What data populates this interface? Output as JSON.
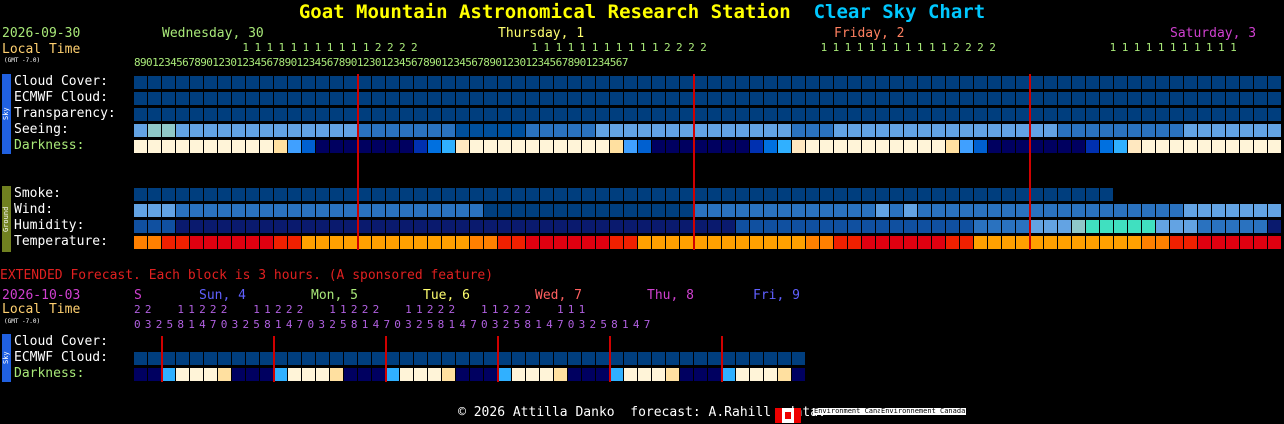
{
  "title": "Goat Mountain Astronomical Research Station",
  "title_suffix": "Clear Sky Chart",
  "main": {
    "date": "2026-09-30",
    "local_time": "Local Time",
    "gmt": "(GMT -7.0)",
    "days": [
      {
        "label": "Wednesday, 30",
        "color": "#a8e878"
      },
      {
        "label": "Thursday, 1",
        "color": "#ffff70"
      },
      {
        "label": "Friday, 2",
        "color": "#ff8060"
      },
      {
        "label": "Saturday, 3",
        "color": "#d040d0"
      }
    ],
    "hour_tens": "                  1 1 1 1 1 1 1 1 1 1 1 2 2 2 2                   1 1 1 1 1 1 1 1 1 1 1 2 2 2 2                   1 1 1 1 1 1 1 1 1 1 1 2 2 2 2                   1 1 1 1 1 1 1 1 1 1 1",
    "hour_ones": "8901234567890123012345678901234567890123012345678901234567890123012345678901234567",
    "sky_rows": [
      "Cloud Cover:",
      "ECMWF Cloud:",
      "Transparency:",
      "Seeing:",
      "Darkness:"
    ],
    "ground_rows": [
      "Smoke:",
      "Wind:",
      "Humidity:",
      "Temperature:"
    ],
    "sky_tab": "Sky",
    "ground_tab": "Ground"
  },
  "extended": {
    "header": "EXTENDED Forecast. Each block is 3 hours. (A sponsored feature)",
    "date": "2026-10-03",
    "local_time": "Local Time",
    "gmt": "(GMT -7.0)",
    "days": [
      {
        "label": "S",
        "color": "#d040d0"
      },
      {
        "label": "Sun, 4",
        "color": "#6060ff"
      },
      {
        "label": "Mon, 5",
        "color": "#a8e878"
      },
      {
        "label": "Tue, 6",
        "color": "#ffff70"
      },
      {
        "label": "Wed, 7",
        "color": "#ff6060"
      },
      {
        "label": "Thu, 8",
        "color": "#d040d0"
      },
      {
        "label": "Fri, 9",
        "color": "#6060ff"
      }
    ],
    "hour_tens": "2 2     1 1 2 2 2     1 1 2 2 2     1 1 2 2 2     1 1 2 2 2     1 1 2 2 2     1 1 1",
    "hour_ones": "0 3 2 5 8 1 4 7 0 3 2 5 8 1 4 7 0 3 2 5 8 1 4 7 0 3 2 5 8 1 4 7 0 3 2 5 8 1 4 7 0 3 2 5 8 1 4 7",
    "rows": [
      "Cloud Cover:",
      "ECMWF Cloud:",
      "Darkness:"
    ],
    "sky_tab": "Sky"
  },
  "footer": {
    "copyright": "© 2026 Attilla Danko  forecast: A.Rahill  data:",
    "env1": "Environment Canada",
    "env2": "Environnement Canada"
  },
  "colors": {
    "cloud_clear": "#003e7e",
    "ecmwf_dark": "#004080",
    "seeing_light": "#63a3e3",
    "darkness_day": "#ffffff",
    "grid_line": "#d00000"
  }
}
